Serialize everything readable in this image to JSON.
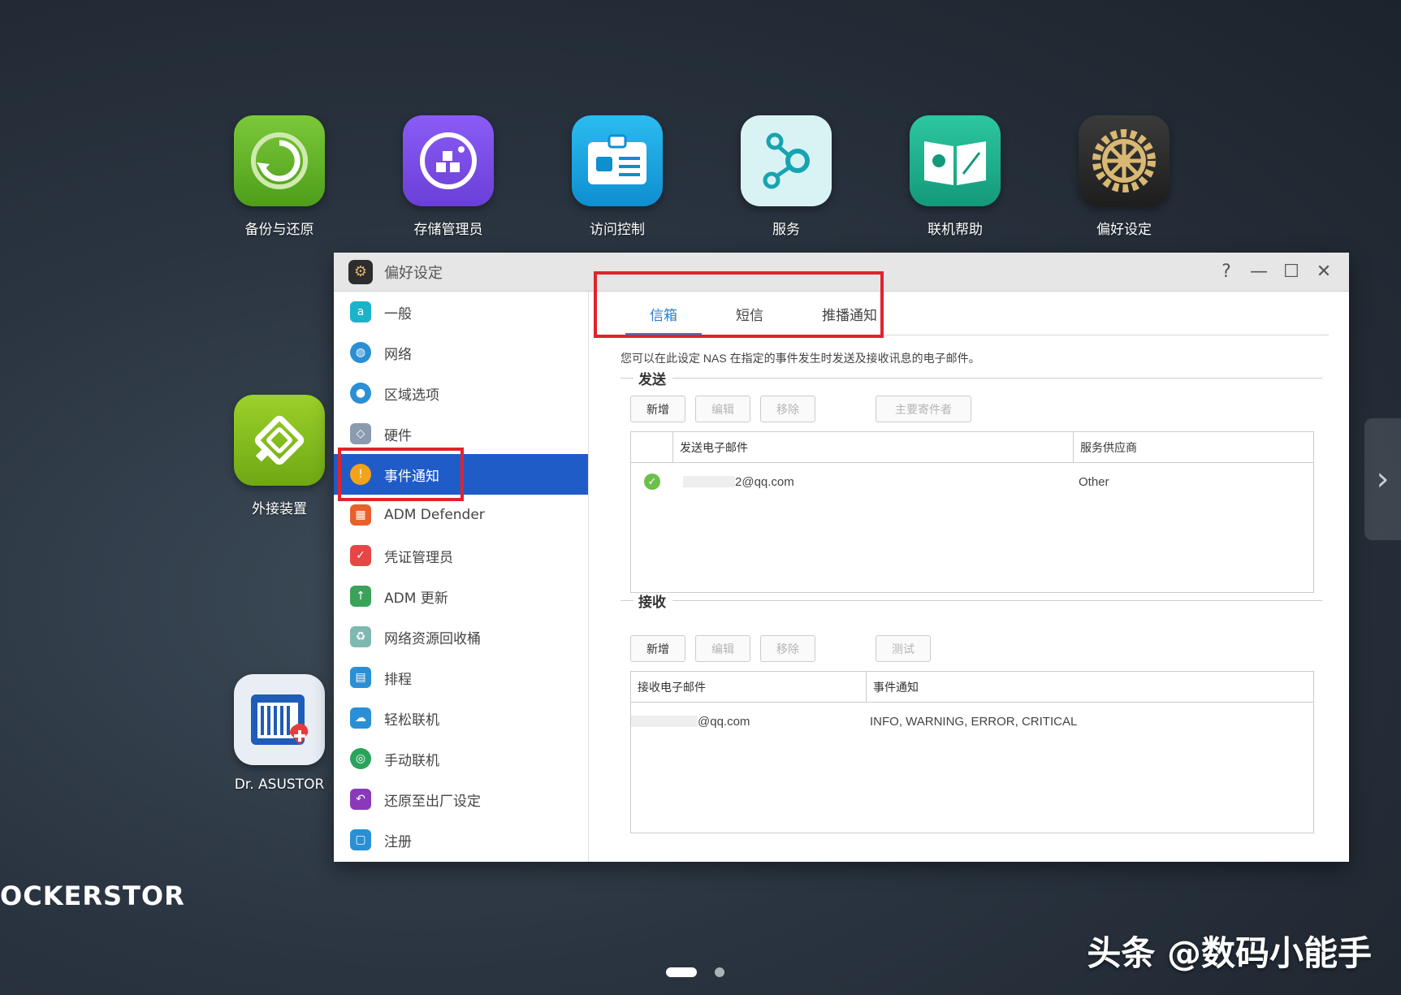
{
  "desktop": {
    "apps": [
      {
        "label": "备份与还原",
        "icon": "backup-restore-icon",
        "color": "#6ab42a"
      },
      {
        "label": "存储管理员",
        "icon": "storage-manager-icon",
        "color": "#7b4be8"
      },
      {
        "label": "访问控制",
        "icon": "access-control-icon",
        "color": "#1aa7e0"
      },
      {
        "label": "服务",
        "icon": "services-icon",
        "color": "#d9f3f5"
      },
      {
        "label": "联机帮助",
        "icon": "online-help-icon",
        "color": "#1fb38f"
      },
      {
        "label": "偏好设定",
        "icon": "preferences-gear-icon",
        "color": "#2d2d2d"
      },
      {
        "label": "外接装置",
        "icon": "external-devices-icon",
        "color": "#8cc21f"
      },
      {
        "label": "Dr. ASUSTOR",
        "icon": "dr-asustor-icon",
        "color": "#e9eef4"
      }
    ],
    "brand": "OCKERSTOR",
    "watermark": "头条 @数码小能手"
  },
  "window": {
    "title": "偏好设定",
    "controls": {
      "help": "?",
      "minimize": "—",
      "maximize": "☐",
      "close": "✕"
    }
  },
  "sidebar": {
    "items": [
      {
        "label": "一般",
        "icon": "general-icon",
        "color": "#1ab3c9"
      },
      {
        "label": "网络",
        "icon": "network-globe-icon",
        "color": "#2a8fd4"
      },
      {
        "label": "区域选项",
        "icon": "region-options-icon",
        "color": "#2a8fd4"
      },
      {
        "label": "硬件",
        "icon": "hardware-icon",
        "color": "#8a9bb0"
      },
      {
        "label": "事件通知",
        "icon": "event-notification-icon",
        "color": "#f3a31b",
        "active": true
      },
      {
        "label": "ADM Defender",
        "icon": "adm-defender-icon",
        "color": "#e8602a"
      },
      {
        "label": "凭证管理员",
        "icon": "certificate-manager-icon",
        "color": "#e84545"
      },
      {
        "label": "ADM 更新",
        "icon": "adm-update-icon",
        "color": "#3aa35a"
      },
      {
        "label": "网络资源回收桶",
        "icon": "recycle-bin-icon",
        "color": "#7fb8b0"
      },
      {
        "label": "排程",
        "icon": "schedule-icon",
        "color": "#2a8fd4"
      },
      {
        "label": "轻松联机",
        "icon": "ez-connect-icon",
        "color": "#2a8fd4"
      },
      {
        "label": "手动联机",
        "icon": "manual-connect-icon",
        "color": "#2aa35a"
      },
      {
        "label": "还原至出厂设定",
        "icon": "factory-reset-icon",
        "color": "#8a3ab9"
      },
      {
        "label": "注册",
        "icon": "registration-icon",
        "color": "#2a8fd4"
      }
    ]
  },
  "tabs": [
    {
      "label": "信箱",
      "active": true
    },
    {
      "label": "短信"
    },
    {
      "label": "推播通知"
    }
  ],
  "description": "您可以在此设定 NAS 在指定的事件发生时发送及接收讯息的电子邮件。",
  "send": {
    "title": "发送",
    "buttons": {
      "add": "新增",
      "edit": "编辑",
      "remove": "移除",
      "primary_sender": "主要寄件者"
    },
    "columns": [
      "",
      "发送电子邮件",
      "服务供应商"
    ],
    "rows": [
      {
        "email": "2@qq.com",
        "provider": "Other",
        "status": "check-icon"
      }
    ]
  },
  "receive": {
    "title": "接收",
    "buttons": {
      "add": "新增",
      "edit": "编辑",
      "remove": "移除",
      "test": "测试"
    },
    "columns": [
      "接收电子邮件",
      "事件通知"
    ],
    "rows": [
      {
        "email": "@qq.com",
        "events": "INFO, WARNING, ERROR, CRITICAL"
      }
    ]
  },
  "side_arrow": "›"
}
